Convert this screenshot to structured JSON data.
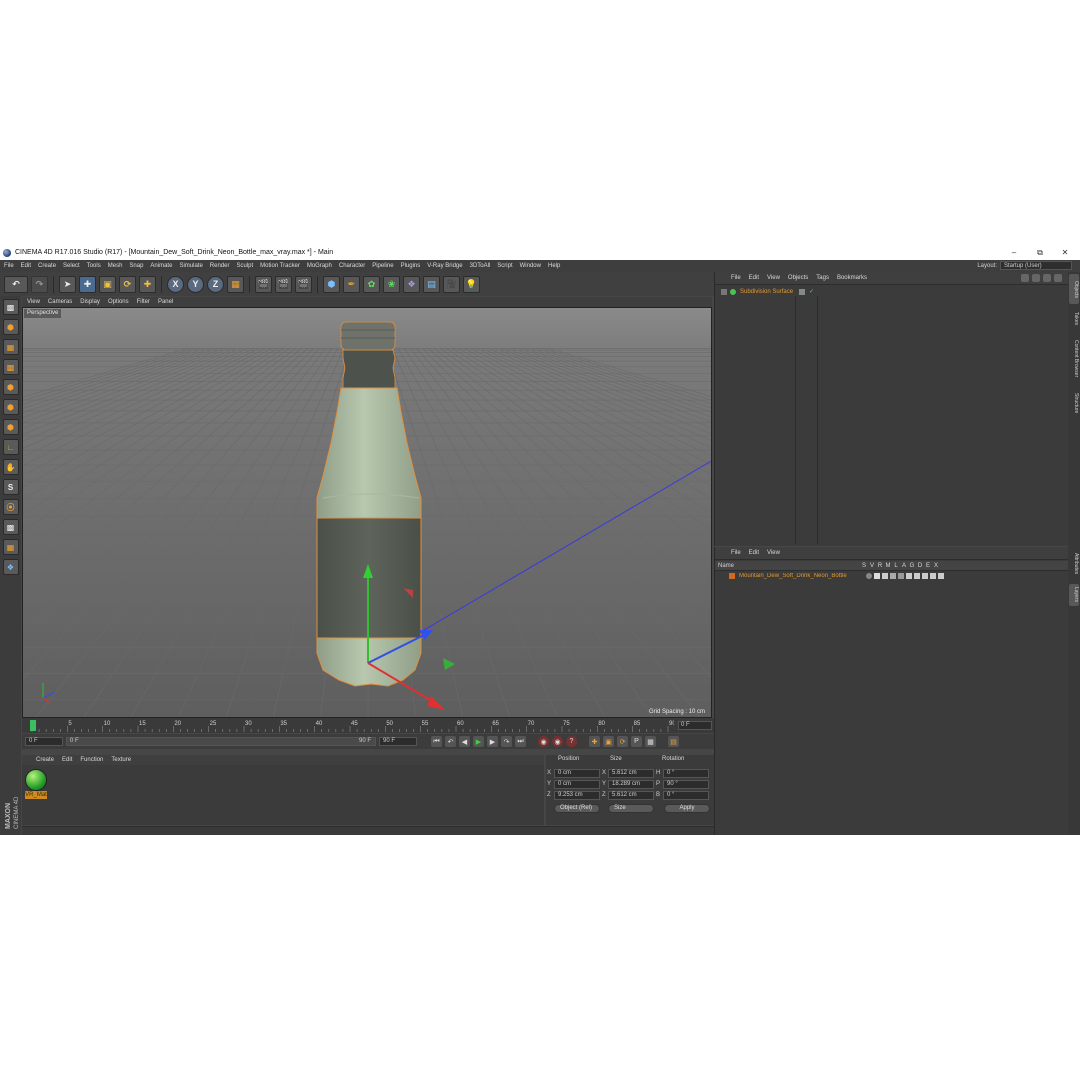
{
  "window": {
    "title": "CINEMA 4D R17.016 Studio (R17) - [Mountain_Dew_Soft_Drink_Neon_Bottle_max_vray.max *] - Main",
    "minimize": "–",
    "maximize": "⧉",
    "close": "✕"
  },
  "menu": [
    "File",
    "Edit",
    "Create",
    "Select",
    "Tools",
    "Mesh",
    "Snap",
    "Animate",
    "Simulate",
    "Render",
    "Sculpt",
    "Motion Tracker",
    "MoGraph",
    "Character",
    "Pipeline",
    "Plugins",
    "V-Ray Bridge",
    "3DToAll",
    "Script",
    "Window",
    "Help"
  ],
  "layout": {
    "label": "Layout:",
    "value": "Startup (User)"
  },
  "toolbar": {
    "x": "X",
    "y": "Y",
    "z": "Z"
  },
  "viewport": {
    "menu": [
      "View",
      "Cameras",
      "Display",
      "Options",
      "Filter",
      "Panel"
    ],
    "label": "Perspective",
    "grid_spacing": "Grid Spacing : 10 cm"
  },
  "timeline": {
    "ticks": [
      "0",
      "5",
      "10",
      "15",
      "20",
      "25",
      "30",
      "35",
      "40",
      "45",
      "50",
      "55",
      "60",
      "65",
      "70",
      "75",
      "80",
      "85",
      "90"
    ],
    "current": "0 F"
  },
  "playbar": {
    "start": "0 F",
    "range_start": "0 F",
    "range_end": "90 F",
    "end": "90 F"
  },
  "materials": {
    "menu": [
      "Create",
      "Edit",
      "Function",
      "Texture"
    ],
    "items": [
      {
        "name": "VR_Mat"
      }
    ]
  },
  "brand": {
    "line1": "MAXON",
    "line2": "CINEMA 4D"
  },
  "coords": {
    "headers": {
      "position": "Position",
      "size": "Size",
      "rotation": "Rotation"
    },
    "rows": [
      {
        "pa": "X",
        "pv": "0 cm",
        "sa": "X",
        "sv": "5.612 cm",
        "ra": "H",
        "rv": "0 °"
      },
      {
        "pa": "Y",
        "pv": "0 cm",
        "sa": "Y",
        "sv": "18.289 cm",
        "ra": "P",
        "rv": "90 °"
      },
      {
        "pa": "Z",
        "pv": "9.253 cm",
        "sa": "Z",
        "sv": "5.612 cm",
        "ra": "B",
        "rv": "0 °"
      }
    ],
    "mode": "Object (Rel)",
    "size_mode": "Size",
    "apply": "Apply"
  },
  "objects": {
    "menu": [
      "File",
      "Edit",
      "View",
      "Objects",
      "Tags",
      "Bookmarks"
    ],
    "item": "Subdivision Surface"
  },
  "layers": {
    "menu": [
      "File",
      "Edit",
      "View"
    ],
    "name_header": "Name",
    "cols": [
      "S",
      "V",
      "R",
      "M",
      "L",
      "A",
      "G",
      "D",
      "E",
      "X"
    ],
    "item": "Mountain_Dew_Soft_Drink_Neon_Bottle",
    "layer_color": "#d2691e"
  },
  "right_tabs": [
    "Objects",
    "Takes",
    "Content Browser",
    "Structure",
    "Attributes",
    "Layers"
  ]
}
